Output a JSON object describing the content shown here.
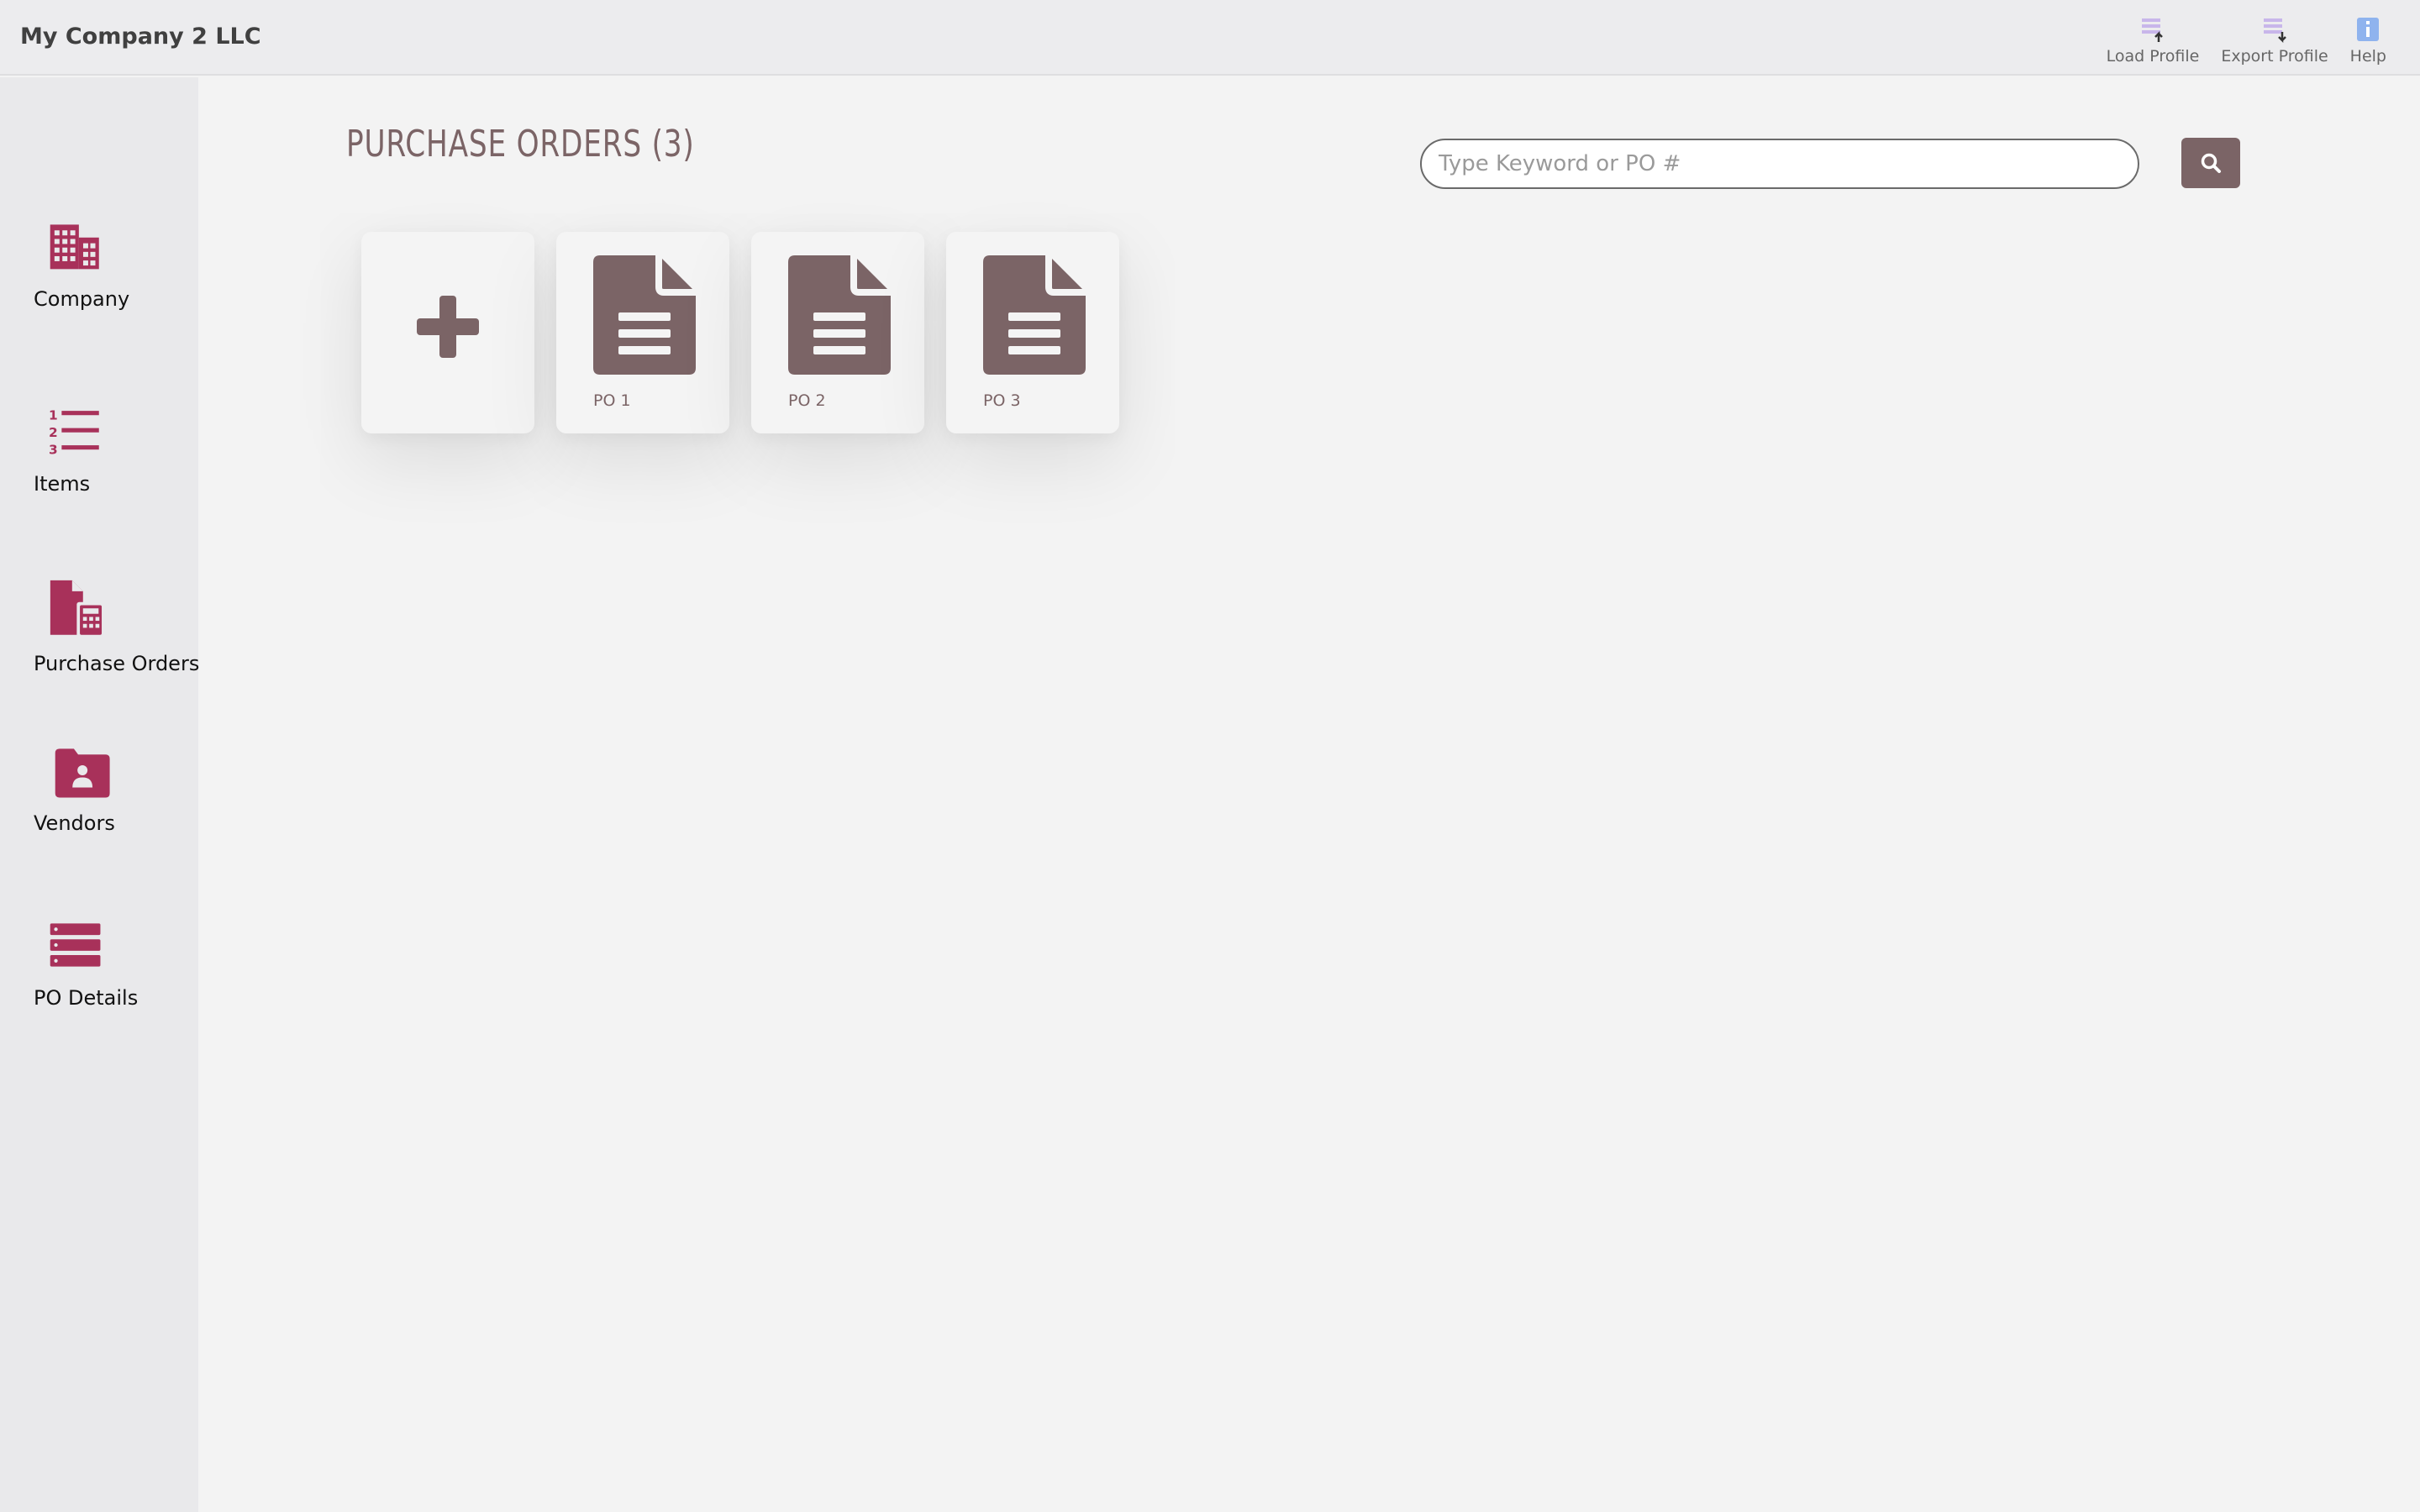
{
  "app": {
    "title": "My Company 2 LLC"
  },
  "toolbar": {
    "load_profile": "Load Profile",
    "export_profile": "Export Profile",
    "help": "Help"
  },
  "sidebar": {
    "items": [
      {
        "label": "Company",
        "icon": "building-icon"
      },
      {
        "label": "Items",
        "icon": "numbered-list-icon"
      },
      {
        "label": "Purchase Orders",
        "icon": "file-invoice-icon"
      },
      {
        "label": "Vendors",
        "icon": "folder-user-icon"
      },
      {
        "label": "PO Details",
        "icon": "server-list-icon"
      }
    ]
  },
  "main": {
    "title": "PURCHASE ORDERS (3)",
    "search": {
      "placeholder": "Type Keyword or PO #",
      "value": ""
    },
    "cards": [
      {
        "label": "PO 1"
      },
      {
        "label": "PO 2"
      },
      {
        "label": "PO 3"
      }
    ]
  },
  "colors": {
    "accent": "#a8315a",
    "brown": "#7b6466",
    "toolbar_icon": "#c8b6ea",
    "help_icon": "#8fb3ee"
  }
}
